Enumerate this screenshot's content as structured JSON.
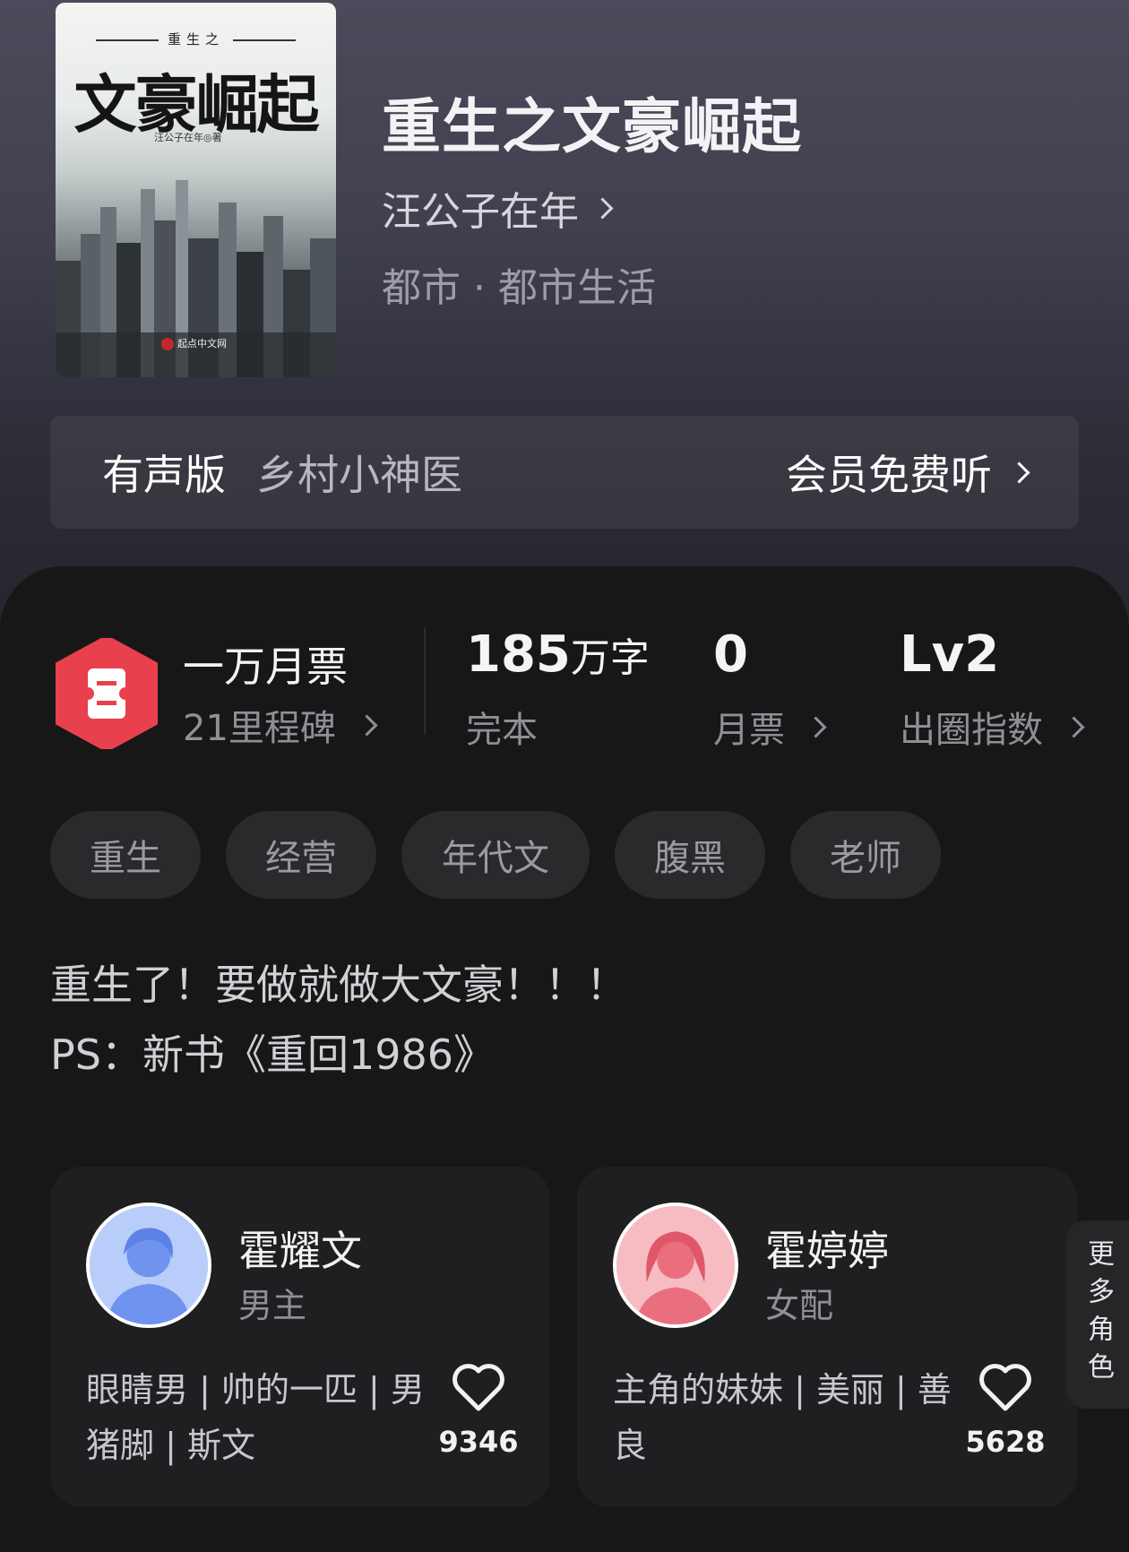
{
  "book": {
    "cover": {
      "subtitle": "重生之",
      "main_title": "文豪崛起",
      "author_line": "汪公子在年◎著",
      "publisher": "起点中文网"
    },
    "title": "重生之文豪崛起",
    "author": "汪公子在年",
    "genre": "都市 · 都市生活"
  },
  "audio": {
    "label": "有声版",
    "name": "乡村小神医",
    "action": "会员免费听"
  },
  "stats": {
    "ticket_title": "一万月票",
    "ticket_sub": "21里程碑",
    "words_value": "185",
    "words_unit": "万字",
    "words_label": "完本",
    "monthly_value": "0",
    "monthly_label": "月票",
    "influence_value": "Lv2",
    "influence_label": "出圈指数"
  },
  "tags": [
    "重生",
    "经营",
    "年代文",
    "腹黑",
    "老师"
  ],
  "description": {
    "line1": "重生了！要做就做大文豪！！！",
    "line2": "PS：新书《重回1986》"
  },
  "characters": [
    {
      "name": "霍耀文",
      "role": "男主",
      "desc": "眼睛男 | 帅的一匹 | 男猪脚 | 斯文",
      "likes": "9346",
      "avatar_color": "#8fb0f5"
    },
    {
      "name": "霍婷婷",
      "role": "女配",
      "desc": "主角的妹妹 | 美丽 | 善良",
      "likes": "5628",
      "avatar_color": "#f08f98"
    }
  ],
  "more_roles": "更多角色",
  "colors": {
    "ticket_red": "#e8414d",
    "background": "#171717"
  }
}
